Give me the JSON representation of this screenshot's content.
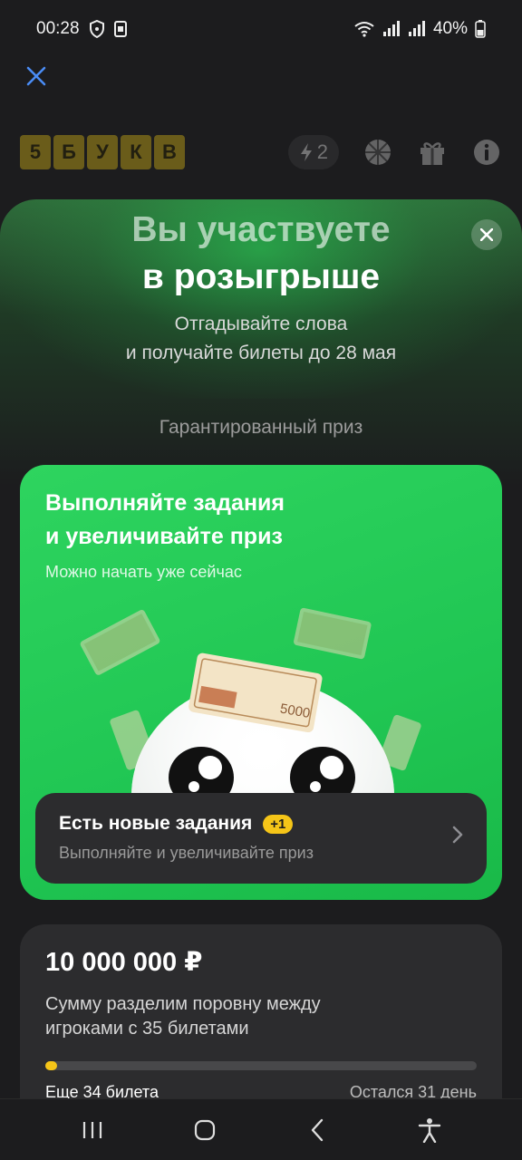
{
  "status_bar": {
    "time": "00:28",
    "battery": "40%"
  },
  "icons": {
    "top_close": "close-icon",
    "sheet_close": "close-icon",
    "energy": "lightning-icon",
    "wheel": "wheel-icon",
    "gift": "gift-icon",
    "info": "info-icon",
    "chevron": "chevron-right-icon"
  },
  "game_header": {
    "logo_letters": [
      "5",
      "Б",
      "У",
      "К",
      "В"
    ],
    "energy_count": "2"
  },
  "sheet": {
    "title_line1": "Вы участвуете",
    "title_line2": "в розыгрыше",
    "subtitle_line1": "Отгадывайте слова",
    "subtitle_line2": "и получайте билеты до 28 мая",
    "section_label": "Гарантированный приз"
  },
  "tasks_card": {
    "title_line1": "Выполняйте задания",
    "title_line2": "и увеличивайте приз",
    "subtitle": "Можно начать уже сейчас",
    "banknote_value": "5000",
    "panel_title": "Есть новые задания",
    "panel_badge": "+1",
    "panel_subtitle": "Выполняйте и увеличивайте приз"
  },
  "prize_card": {
    "amount": "10 000 000 ₽",
    "description_line1": "Сумму разделим поровну между",
    "description_line2": "игроками с 35 билетами",
    "progress_fraction": 0.02,
    "tickets_left": "Еще 34 билета",
    "days_left": "Остался 31 день"
  },
  "colors": {
    "accent_green": "#22c957",
    "accent_yellow": "#f5c518",
    "link_blue": "#4a8cf5",
    "background": "#1c1c1e",
    "card": "#2c2c2e"
  }
}
